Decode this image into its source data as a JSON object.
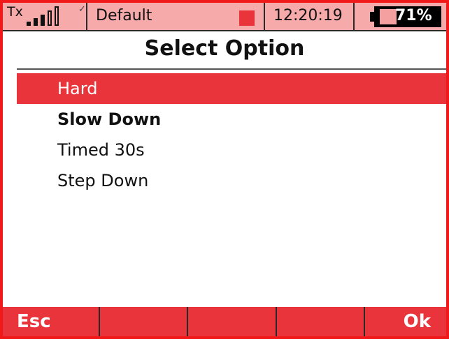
{
  "status_bar": {
    "tx_label": "Tx",
    "signal_bars": 5,
    "signal_bars_filled": 3,
    "check_glyph": "✓",
    "model_name": "Default",
    "model_indicator_color": "#e8343a",
    "time": "12:20:19",
    "battery": {
      "percent_text": "71%",
      "level": 0.71
    }
  },
  "screen": {
    "title": "Select Option"
  },
  "options": {
    "items": [
      {
        "label": "Hard",
        "selected": true,
        "bold": false
      },
      {
        "label": "Slow Down",
        "selected": false,
        "bold": true
      },
      {
        "label": "Timed 30s",
        "selected": false,
        "bold": false
      },
      {
        "label": "Step Down",
        "selected": false,
        "bold": false
      }
    ]
  },
  "softkeys": {
    "esc": "Esc",
    "key2": "",
    "key3": "",
    "key4": "",
    "ok": "Ok"
  },
  "colors": {
    "accent": "#e8343a",
    "frame": "#f01818",
    "status_bg": "#f6aaaa"
  }
}
